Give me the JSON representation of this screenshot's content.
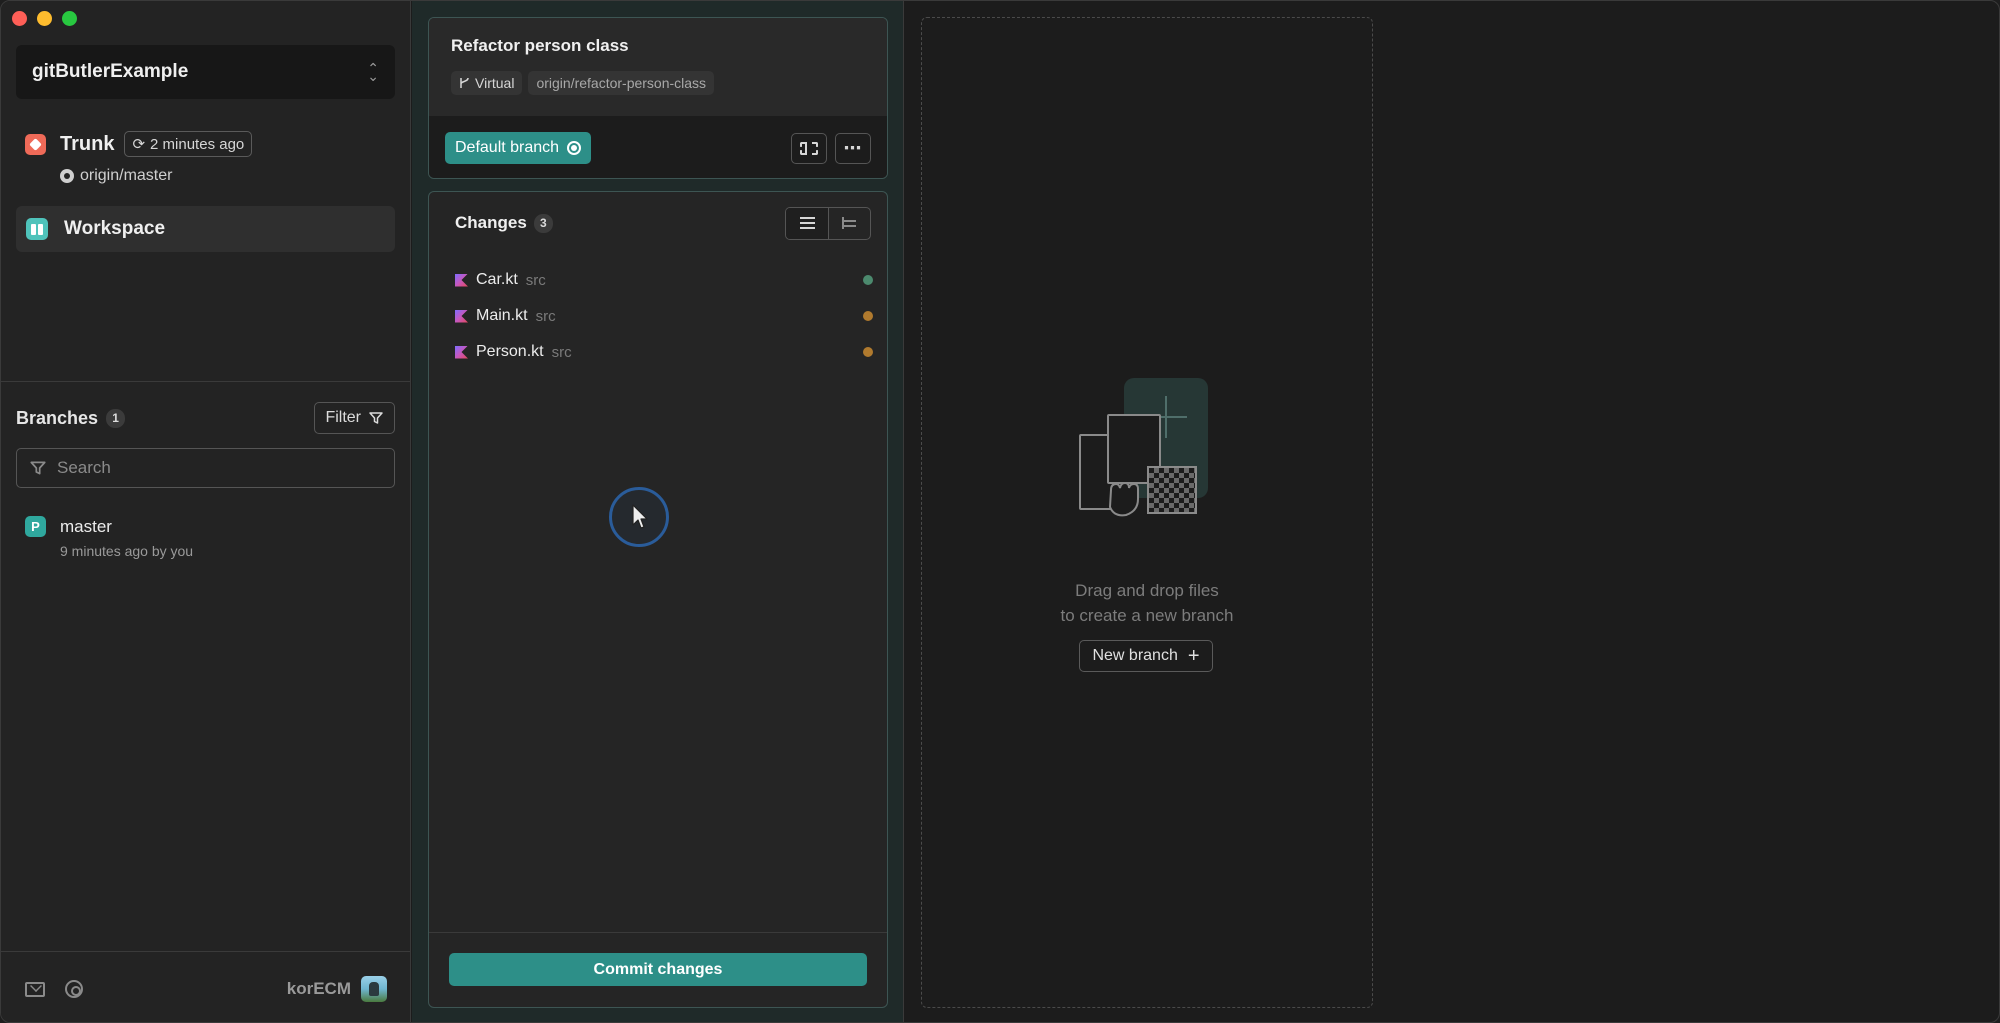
{
  "sidebar": {
    "project_name": "gitButlerExample",
    "trunk": {
      "label": "Trunk",
      "sync_time": "2 minutes ago",
      "remote": "origin/master"
    },
    "workspace_label": "Workspace",
    "branches": {
      "title": "Branches",
      "count": "1",
      "filter_label": "Filter",
      "search_placeholder": "Search",
      "items": [
        {
          "name": "master",
          "meta": "9 minutes ago by you",
          "icon_letter": "P"
        }
      ]
    },
    "footer": {
      "username": "korECM"
    }
  },
  "lane": {
    "branch_title": "Refactor person class",
    "tag_virtual": "Virtual",
    "tag_remote": "origin/refactor-person-class",
    "default_branch_label": "Default branch",
    "changes": {
      "title": "Changes",
      "count": "3",
      "files": [
        {
          "name": "Car.kt",
          "path": "src",
          "status_color": "#4c8a6e"
        },
        {
          "name": "Main.kt",
          "path": "src",
          "status_color": "#b07a2e"
        },
        {
          "name": "Person.kt",
          "path": "src",
          "status_color": "#b07a2e"
        }
      ]
    },
    "commit_label": "Commit changes"
  },
  "dropzone": {
    "line1": "Drag and drop files",
    "line2": "to create a new branch",
    "new_branch_label": "New branch"
  },
  "colors": {
    "accent": "#2d8f88",
    "trunk_icon": "#ef6a58",
    "workspace_icon": "#4fc3bb",
    "branch_icon": "#2fa89e"
  }
}
